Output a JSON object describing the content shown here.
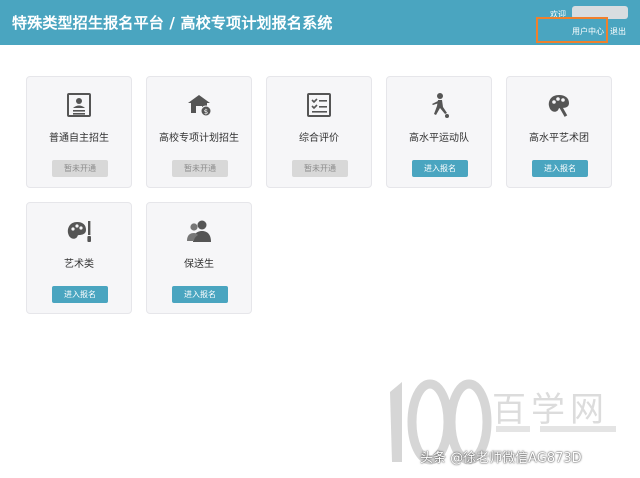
{
  "header": {
    "title": "特殊类型招生报名平台 / 高校专项计划报名系统",
    "welcome": "欢迎",
    "user_center": "用户中心",
    "logout": "退出"
  },
  "colors": {
    "header_bg": "#4aa5c0",
    "active_button": "#4aa5c0",
    "disabled_button": "#d8d8d8",
    "highlight_box": "#f0802c"
  },
  "cards": [
    {
      "label": "普通自主招生",
      "icon": "profile-card-icon",
      "button": "暂未开通",
      "enabled": false
    },
    {
      "label": "高校专项计划招生",
      "icon": "school-money-icon",
      "button": "暂未开通",
      "enabled": false
    },
    {
      "label": "综合评价",
      "icon": "checklist-icon",
      "button": "暂未开通",
      "enabled": false
    },
    {
      "label": "高水平运动队",
      "icon": "athlete-icon",
      "button": "进入报名",
      "enabled": true
    },
    {
      "label": "高水平艺术团",
      "icon": "art-palette-icon",
      "button": "进入报名",
      "enabled": true
    },
    {
      "label": "艺术类",
      "icon": "palette-brush-icon",
      "button": "进入报名",
      "enabled": true
    },
    {
      "label": "保送生",
      "icon": "users-icon",
      "button": "进入报名",
      "enabled": true
    }
  ],
  "watermark": {
    "text": "百学网",
    "logo_text": "100",
    "caption": "头条 @徐老师微信AG873D"
  }
}
